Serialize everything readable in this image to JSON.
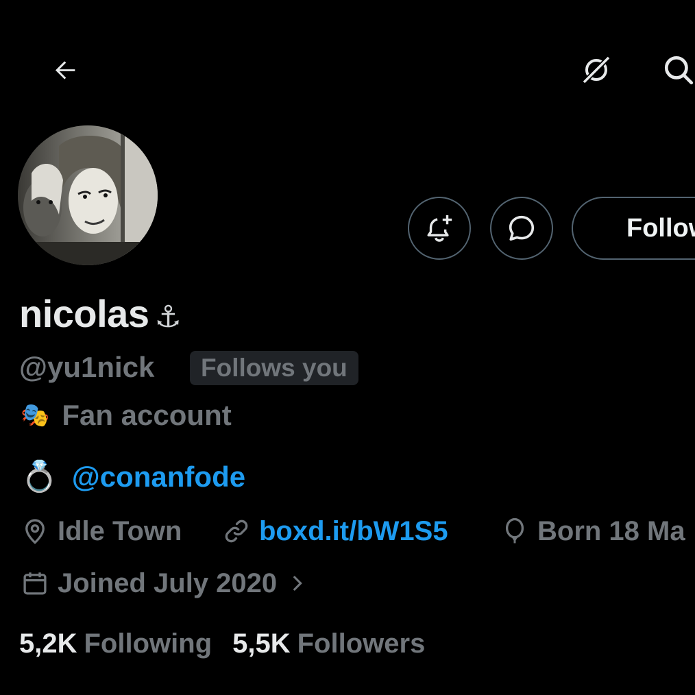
{
  "profile": {
    "display_name": "nicolas",
    "name_emoji": "⚓",
    "handle": "@yu1nick",
    "follows_you_badge": "Follows you",
    "label_emoji": "🎭",
    "label": "Fan account",
    "bio_emoji": "💍",
    "bio_mention": "@conanfode",
    "location": "Idle Town",
    "website": "boxd.it/bW1S5",
    "birthday": "Born 18 Ma",
    "joined": "Joined July 2020",
    "following_count": "5,2K",
    "following_label": "Following",
    "followers_count": "5,5K",
    "followers_label": "Followers"
  },
  "actions": {
    "follow_label": "Follow"
  },
  "icons": {
    "back": "arrow-left-icon",
    "grok": "grok-icon",
    "search": "search-icon",
    "notify": "bell-plus-icon",
    "message": "chat-bubble-icon",
    "location": "map-pin-icon",
    "link": "link-icon",
    "birthday": "balloon-icon",
    "calendar": "calendar-icon",
    "chevron": "chevron-right-icon"
  },
  "colors": {
    "background": "#000000",
    "text_primary": "#e7e9ea",
    "text_secondary": "#71767b",
    "accent": "#1d9bf0",
    "border": "#536471",
    "badge_bg": "#202327"
  }
}
